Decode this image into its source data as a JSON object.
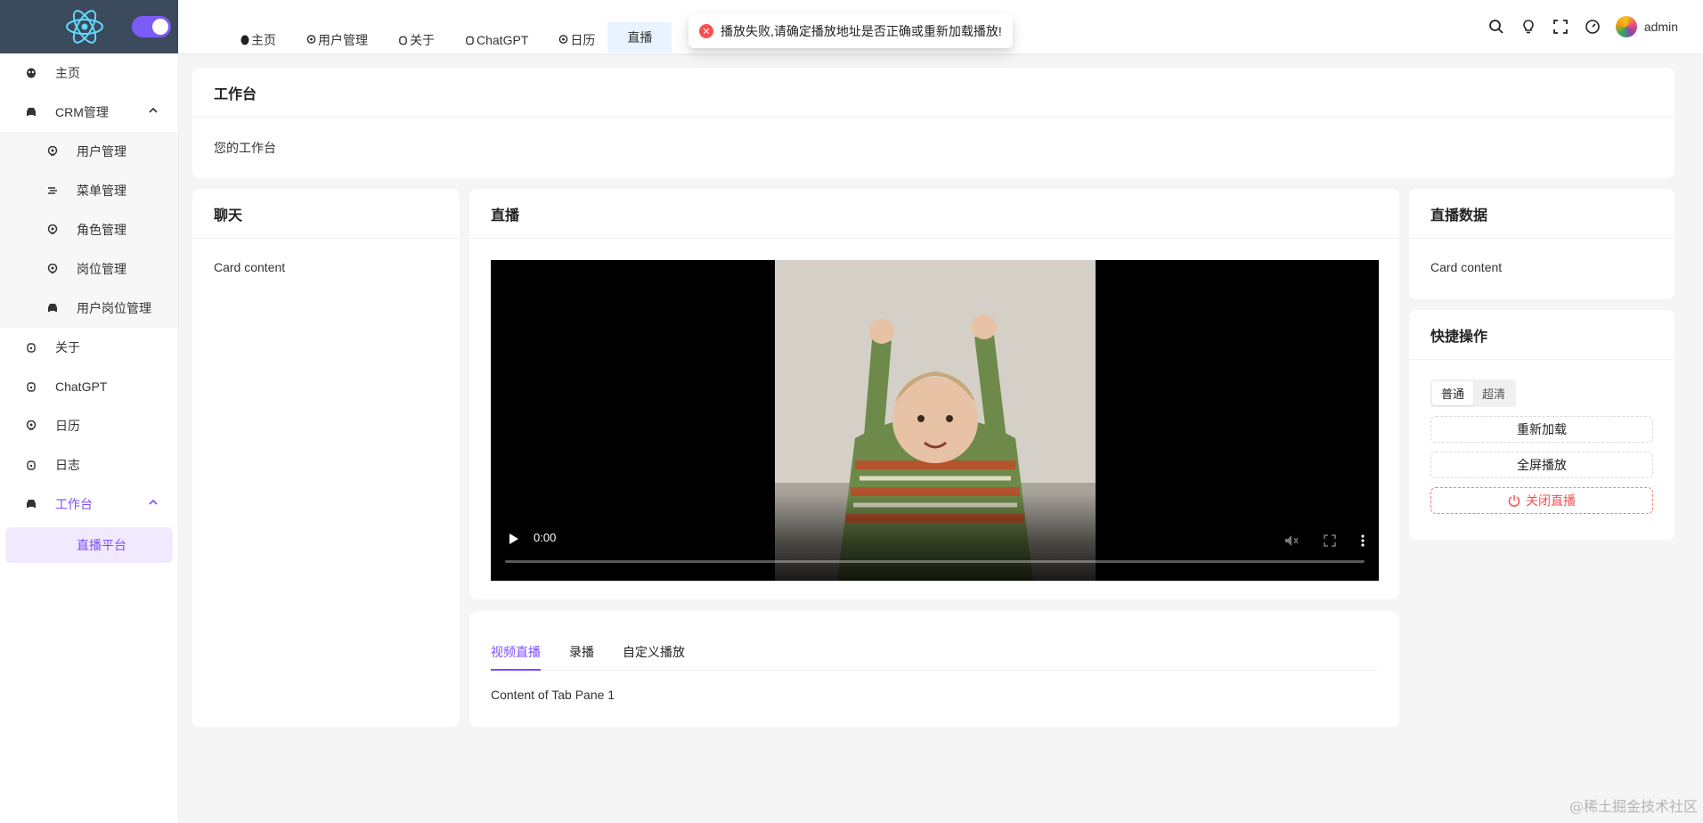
{
  "sidebar": {
    "items": [
      {
        "label": "主页",
        "icon": "alien-icon"
      },
      {
        "label": "CRM管理",
        "icon": "car-icon",
        "expanded": true
      },
      {
        "label": "用户管理",
        "icon": "pin-icon",
        "sub": true
      },
      {
        "label": "菜单管理",
        "icon": "menu-icon",
        "sub": true
      },
      {
        "label": "角色管理",
        "icon": "pin-icon",
        "sub": true
      },
      {
        "label": "岗位管理",
        "icon": "pin-icon",
        "sub": true
      },
      {
        "label": "用户岗位管理",
        "icon": "car-icon",
        "sub": true
      },
      {
        "label": "关于",
        "icon": "robot-icon"
      },
      {
        "label": "ChatGPT",
        "icon": "robot-icon"
      },
      {
        "label": "日历",
        "icon": "pin-icon"
      },
      {
        "label": "日志",
        "icon": "robot-icon"
      },
      {
        "label": "工作台",
        "icon": "car-icon",
        "expanded": true
      },
      {
        "label": "直播平台",
        "sub": true,
        "selected": true
      }
    ]
  },
  "header": {
    "tabs": [
      {
        "label": "主页"
      },
      {
        "label": "用户管理"
      },
      {
        "label": "关于"
      },
      {
        "label": "ChatGPT"
      },
      {
        "label": "日历"
      },
      {
        "label": "直播"
      }
    ],
    "username": "admin"
  },
  "toast": {
    "message": "播放失败,请确定播放地址是否正确或重新加载播放!"
  },
  "workbench": {
    "title": "工作台",
    "content": "您的工作台"
  },
  "chat": {
    "title": "聊天",
    "content": "Card content"
  },
  "live": {
    "title": "直播",
    "time": "0:00"
  },
  "live_data": {
    "title": "直播数据",
    "content": "Card content"
  },
  "quick": {
    "title": "快捷操作",
    "quality_options": [
      "普通",
      "超清"
    ],
    "reload": "重新加载",
    "fullscreen": "全屏播放",
    "close_live": "关闭直播"
  },
  "tabs2": {
    "items": [
      "视频直播",
      "录播",
      "自定义播放"
    ],
    "pane_content": "Content of Tab Pane 1"
  },
  "watermark": "@稀土掘金技术社区",
  "colors": {
    "accent": "#7c4dff",
    "danger": "#ff4d4f",
    "sidebar_top": "#3c4a5e"
  }
}
